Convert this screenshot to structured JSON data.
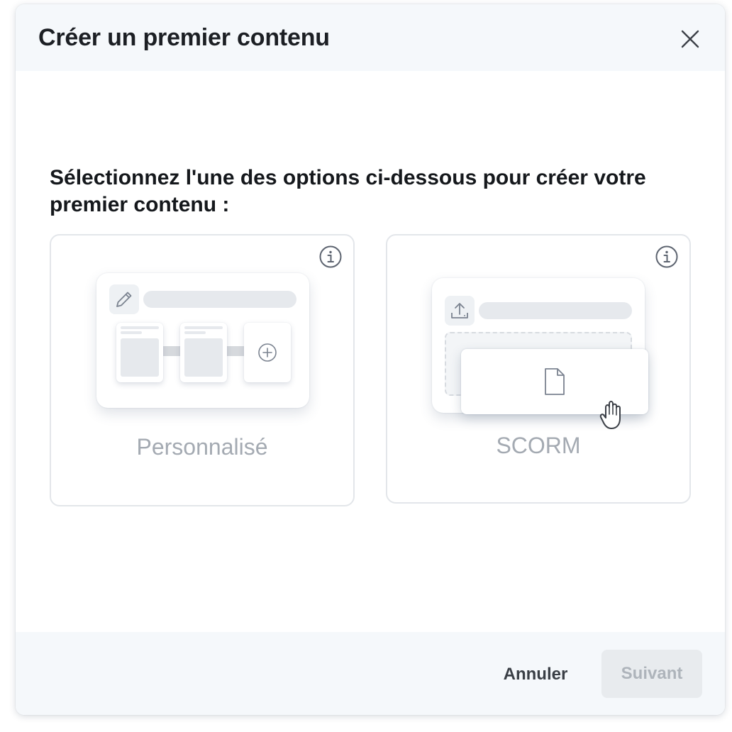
{
  "dialog": {
    "title": "Créer un premier contenu",
    "prompt": "Sélectionnez l'une des options ci-dessous pour créer votre premier contenu :"
  },
  "options": [
    {
      "label": "Personnalisé",
      "icon": "pencil-icon"
    },
    {
      "label": "SCORM",
      "icon": "upload-icon"
    }
  ],
  "footer": {
    "cancel_label": "Annuler",
    "next_label": "Suivant",
    "next_disabled": true
  },
  "colors": {
    "header_bg": "#f5f8fb",
    "title": "#1c1f24",
    "muted_label": "#a4aab2",
    "disabled_button_bg": "#e8ebee"
  }
}
